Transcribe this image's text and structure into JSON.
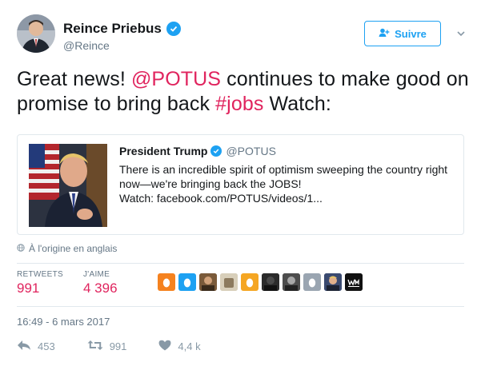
{
  "header": {
    "display_name": "Reince Priebus",
    "handle": "@Reince",
    "follow_label": "Suivre"
  },
  "tweet": {
    "part1": "Great news! ",
    "mention": "@POTUS",
    "part2": " continues to make good on promise to bring back ",
    "hashtag": "#jobs",
    "part3": " Watch:"
  },
  "quote": {
    "name": "President Trump",
    "handle": "@POTUS",
    "line1": "There is an incredible spirit of optimism sweeping the country right",
    "line2": "now—we're bringing back the JOBS!",
    "line3": "Watch: facebook.com/POTUS/videos/1..."
  },
  "translate_label": "À l'origine en anglais",
  "stats": {
    "retweets_label": "RETWEETS",
    "retweets_value": "991",
    "likes_label": "J'AIME",
    "likes_value": "4 396"
  },
  "timestamp": "16:49 - 6 mars 2017",
  "actions": {
    "reply_count": "453",
    "retweet_count": "991",
    "like_count": "4,4 k"
  },
  "colors": {
    "accent": "#1da1f2",
    "link": "#e0245e",
    "muted": "#657786"
  },
  "liker_avatars": [
    "egg-icon",
    "egg-icon",
    "photo",
    "photo",
    "egg-icon",
    "photo",
    "photo",
    "egg-icon",
    "photo",
    "wm-logo"
  ]
}
